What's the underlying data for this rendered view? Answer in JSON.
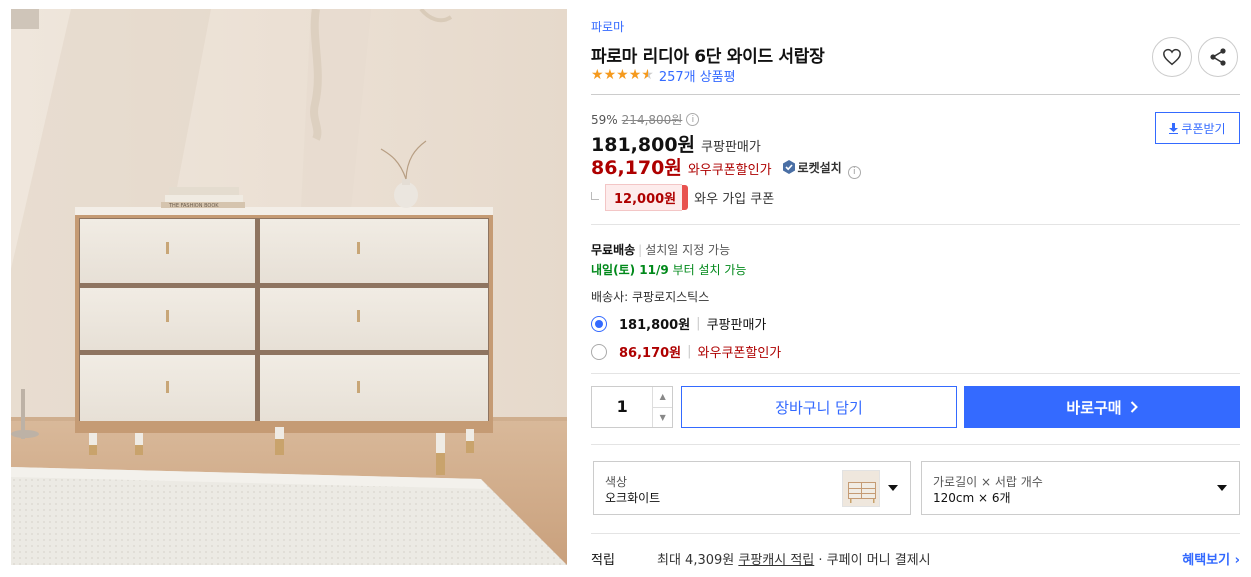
{
  "product": {
    "brand": "파로마",
    "title": "파로마 리디아 6단 와이드 서랍장",
    "rating": 4.5,
    "review_count": "257개 상품평"
  },
  "image": {
    "book_text": "THE FASHION BOOK"
  },
  "pricing": {
    "discount_rate": "59%",
    "original_price": "214,800원",
    "sale_price": "181,800원",
    "sale_label": "쿠팡판매가",
    "wow_price": "86,170원",
    "wow_label": "와우쿠폰할인가",
    "install_badge": "로켓설치",
    "coupon_amount": "12,000원",
    "coupon_label": "와우 가입 쿠폰",
    "coupon_button": "쿠폰받기"
  },
  "shipping": {
    "free_label": "무료배송",
    "install_note": "설치일 지정 가능",
    "arrival_date": "내일(토) 11/9",
    "arrival_suffix": "부터 설치 가능",
    "carrier": "배송사: 쿠팡로지스틱스"
  },
  "price_options": [
    {
      "amount": "181,800원",
      "label": "쿠팡판매가",
      "selected": true
    },
    {
      "amount": "86,170원",
      "label": "와우쿠폰할인가",
      "selected": false
    }
  ],
  "purchase": {
    "quantity": "1",
    "cart_label": "장바구니 담기",
    "buy_label": "바로구매"
  },
  "options": {
    "color": {
      "title": "색상",
      "value": "오크화이트"
    },
    "size": {
      "title": "가로길이 × 서랍 개수",
      "value": "120cm × 6개"
    }
  },
  "earn": {
    "label": "적립",
    "prefix": "최대 4,309원 ",
    "link": "쿠팡캐시 적립",
    "suffix": " · 쿠페이 머니 결제시",
    "benefit_link": "혜택보기"
  },
  "colors": {
    "accent": "#346aff",
    "wow_red": "#ae0000",
    "star": "#f59a1e",
    "green": "#00891a"
  }
}
